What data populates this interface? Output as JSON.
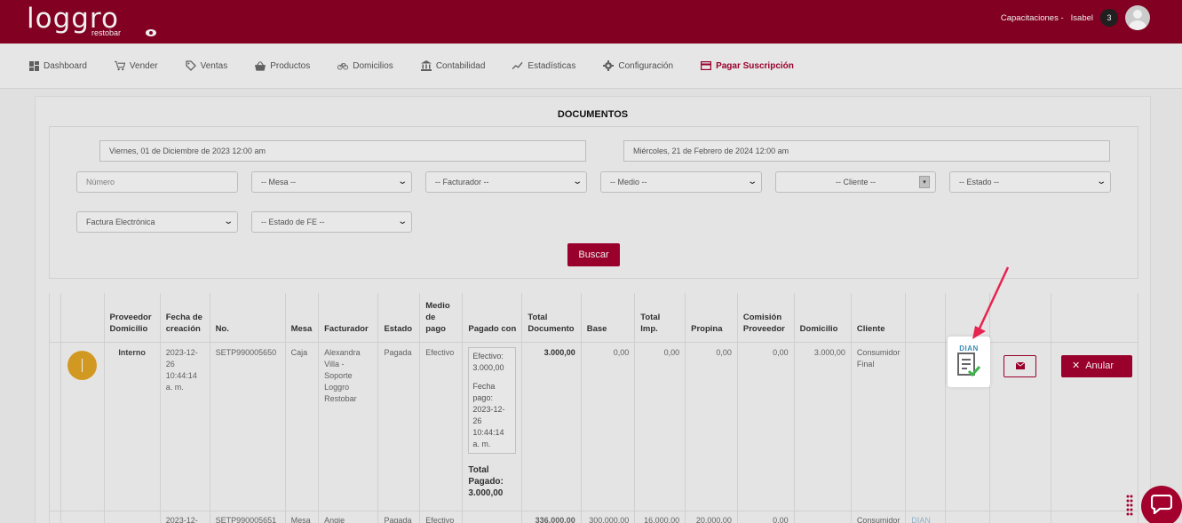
{
  "header": {
    "logo_text": "loggro",
    "logo_sub": "restobar",
    "user_company": "Capacitaciones -",
    "user_name": "Isabel",
    "notification_count": "3"
  },
  "nav": {
    "items": [
      {
        "label": "Dashboard",
        "icon": "dashboard-icon"
      },
      {
        "label": "Vender",
        "icon": "cart-icon"
      },
      {
        "label": "Ventas",
        "icon": "tag-icon"
      },
      {
        "label": "Productos",
        "icon": "basket-icon"
      },
      {
        "label": "Domicilios",
        "icon": "bicycle-icon"
      },
      {
        "label": "Contabilidad",
        "icon": "bank-icon"
      },
      {
        "label": "Estadísticas",
        "icon": "chart-line-icon"
      },
      {
        "label": "Configuración",
        "icon": "gear-icon"
      },
      {
        "label": "Pagar Suscripción",
        "icon": "credit-card-icon"
      }
    ]
  },
  "documents": {
    "title": "DOCUMENTOS",
    "filters": {
      "date_from": "Viernes, 01 de Diciembre de 2023 12:00 am",
      "date_to": "Miércoles, 21 de Febrero de 2024 12:00 am",
      "numero_placeholder": "Número",
      "mesa": "-- Mesa --",
      "facturador": "-- Facturador --",
      "medio": "-- Medio --",
      "cliente": "-- Cliente --",
      "estado": "-- Estado --",
      "tipo_documento": "Factura Electrónica",
      "estado_fe": "-- Estado de FE --",
      "search_button": "Buscar"
    },
    "table": {
      "headers": [
        "Proveedor Domicilio",
        "Fecha de creación",
        "No.",
        "Mesa",
        "Facturador",
        "Estado",
        "Medio de pago",
        "Pagado con",
        "Total Documento",
        "Base",
        "Total Imp.",
        "Propina",
        "Comisión Proveedor",
        "Domicilio",
        "Cliente"
      ],
      "rows": [
        {
          "proveedor": "Interno",
          "fecha": "2023-12-26 10:44:14 a. m.",
          "numero": "SETP990005650",
          "mesa": "Caja",
          "facturador": "Alexandra Villa - Soporte Loggro Restobar",
          "estado": "Pagada",
          "medio": "Efectivo",
          "pagado_con": "Efectivo: 3.000,00",
          "fecha_pago": "Fecha pago: 2023-12-26 10:44:14 a. m.",
          "total_pagado_label": "Total Pagado:",
          "total_pagado": "3.000,00",
          "total": "3.000,00",
          "base": "0,00",
          "impuesto": "0,00",
          "propina": "0,00",
          "comision": "0,00",
          "domicilio": "3.000,00",
          "cliente": "Consumidor Final",
          "dian_label": "DIAN",
          "anular_label": "Anular"
        },
        {
          "fecha": "2023-12-",
          "numero": "SETP990005651",
          "mesa": "Mesa",
          "facturador": "Angie",
          "estado": "Pagada",
          "medio": "Efectivo",
          "total": "336.000,00",
          "base": "300.000,00",
          "impuesto": "16.000,00",
          "propina": "20.000,00",
          "comision": "0,00",
          "cliente": "Consumidor",
          "dian_label": "DIAN"
        }
      ]
    }
  },
  "colors": {
    "brand": "#8b0024",
    "accent": "#a3002e",
    "status_circle": "#e0a325",
    "arrow": "#e8234f"
  }
}
